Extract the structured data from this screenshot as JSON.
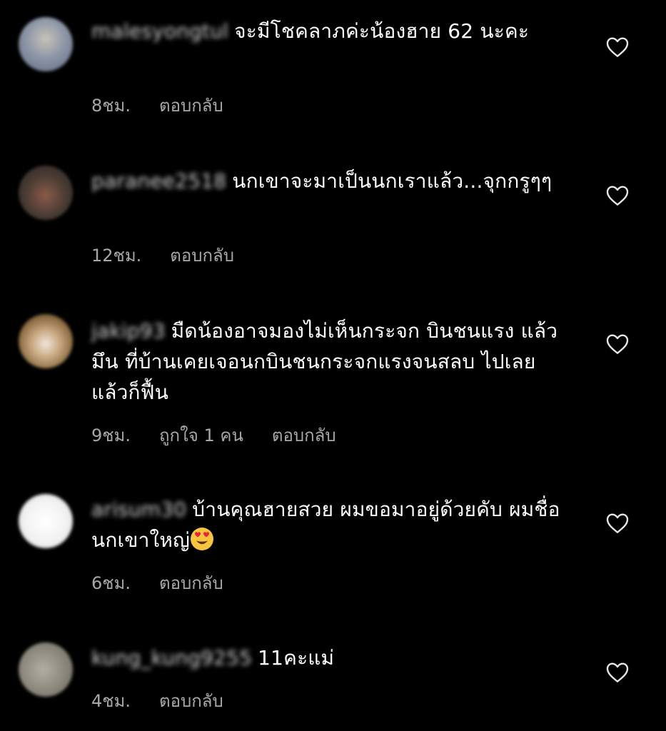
{
  "comments": [
    {
      "username": "malesyongtul",
      "text": "จะมีโชคลาภค่ะน้องฮาย 62 นะคะ",
      "time": "8ชม.",
      "likes": "",
      "reply": "ตอบกลับ",
      "avatar_colors": [
        "#6f7f9a",
        "#c9c2b8"
      ]
    },
    {
      "username": "paranee2518",
      "text": "นกเขาจะมาเป็นนกเราแล้ว...จุกกรูๆๆ",
      "time": "12ชม.",
      "likes": "",
      "reply": "ตอบกลับ",
      "avatar_colors": [
        "#3a332e",
        "#8c5a4a"
      ]
    },
    {
      "username": "jakip93",
      "text": "มืดน้องอาจมองไม่เห็นกระจก บินชนแรง แล้วมึน  ที่บ้านเคยเจอนกบินชนกระจกแรงจนสลบ ไปเลย แล้วก็ฟื้น",
      "time": "9ชม.",
      "likes": "ถูกใจ 1 คน",
      "reply": "ตอบกลับ",
      "avatar_colors": [
        "#8a6a3a",
        "#f0e6dc"
      ]
    },
    {
      "username": "arisum30",
      "text": "บ้านคุณฮายสวย ผมขอมาอยู่ด้วยคับ ผมชื่อ นกเขาใหญ่",
      "time": "6ชม.",
      "likes": "",
      "reply": "ตอบกลับ",
      "avatar_colors": [
        "#ffffff",
        "#dcdcdc"
      ],
      "emoji": "heart-eyes-emoji"
    },
    {
      "username": "kung_kung9255",
      "text": "11คะแม่",
      "time": "4ชม.",
      "likes": "",
      "reply": "ตอบกลับ",
      "avatar_colors": [
        "#7d7a74",
        "#b3aea3"
      ]
    }
  ],
  "colors": {
    "background": "#000000",
    "text": "#ffffff",
    "meta": "#a8a8a8"
  },
  "icons": {
    "like": "heart-outline-icon"
  }
}
